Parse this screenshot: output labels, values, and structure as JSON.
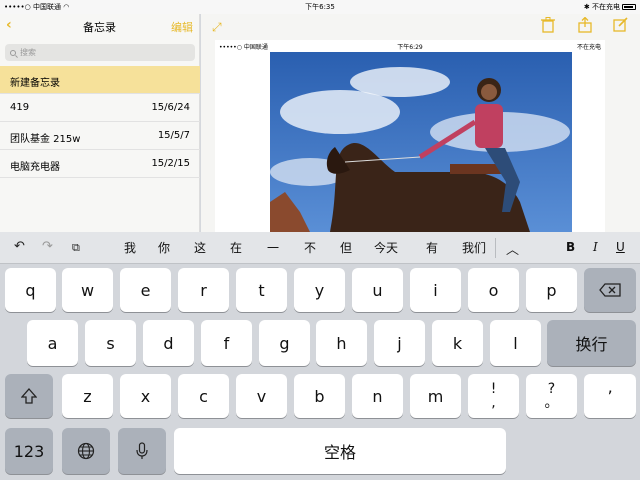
{
  "status_bar": {
    "carrier": "•••••○ 中国联通",
    "wifi_icon": "wifi-icon",
    "time": "下午6:35",
    "charging": "不在充电"
  },
  "sidebar": {
    "back_icon": "chevron-left-icon",
    "title": "备忘录",
    "edit_label": "编辑",
    "search_placeholder": "搜索",
    "notes": [
      {
        "title": "新建备忘录",
        "date": ""
      },
      {
        "title": "419",
        "date": "15/6/24"
      },
      {
        "title": "团队基金 215w",
        "date": "15/5/7"
      },
      {
        "title": "电脑充电器",
        "date": "15/2/15"
      }
    ]
  },
  "detail": {
    "toolbar": {
      "expand_icon": "expand-icon",
      "delete_icon": "trash-icon",
      "share_icon": "share-icon",
      "compose_icon": "compose-icon"
    },
    "inner_status": {
      "carrier": "•••••○ 中国联通",
      "time": "下午6:29",
      "charging": "不在充电"
    }
  },
  "keyboard": {
    "suggestions": [
      "我",
      "你",
      "这",
      "在",
      "一",
      "不",
      "但",
      "今天",
      "有",
      "我们"
    ],
    "format_buttons": [
      "B",
      "I",
      "U"
    ],
    "row1": [
      "q",
      "w",
      "e",
      "r",
      "t",
      "y",
      "u",
      "i",
      "o",
      "p"
    ],
    "row2": [
      "a",
      "s",
      "d",
      "f",
      "g",
      "h",
      "j",
      "k",
      "l"
    ],
    "row3": [
      "z",
      "x",
      "c",
      "v",
      "b",
      "n",
      "m"
    ],
    "punct1_top": "!",
    "punct1_bottom": ",",
    "punct2_top": "?",
    "punct2_bottom": "。",
    "apostrophe": "’",
    "return_label": "换行",
    "numbers_label": "123",
    "space_label": "空格"
  },
  "colors": {
    "accent": "#e7b92a",
    "selected_note": "#f6e19a",
    "keyboard_bg": "#d3d6db"
  }
}
